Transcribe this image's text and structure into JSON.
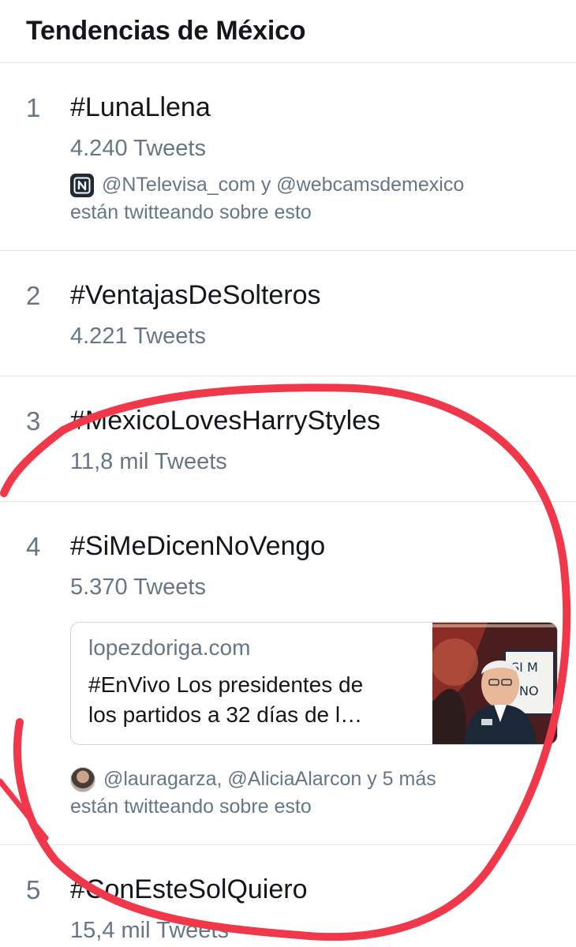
{
  "header": {
    "title": "Tendencias de México"
  },
  "trends": [
    {
      "rank": "1",
      "tag": "#LunaLlena",
      "count": "4.240 Tweets",
      "context_line1": "@NTelevisa_com y @webcamsdemexico",
      "context_line2": "están twitteando sobre esto"
    },
    {
      "rank": "2",
      "tag": "#VentajasDeSolteros",
      "count": "4.221 Tweets"
    },
    {
      "rank": "3",
      "tag": "#MexicoLovesHarryStyles",
      "count": "11,8 mil Tweets"
    },
    {
      "rank": "4",
      "tag": "#SiMeDicenNoVengo",
      "count": "5.370 Tweets",
      "card": {
        "domain": "lopezdoriga.com",
        "title_line1": "#EnVivo Los presidentes de",
        "title_line2": "los partidos a 32 días de l…"
      },
      "context_line1": "@lauragarza, @AliciaAlarcon y 5 más",
      "context_line2": "están twitteando sobre esto"
    },
    {
      "rank": "5",
      "tag": "#ConEsteSolQuiero",
      "count": "15,4 mil Tweets"
    }
  ],
  "colors": {
    "text": "#14171a",
    "secondary": "#657786",
    "divider": "#e1e8ed",
    "annotation": "#f0384a"
  },
  "icons": {
    "trend1_context": "ntelevisa-logo-icon",
    "trend4_context": "user-avatar-icon"
  }
}
